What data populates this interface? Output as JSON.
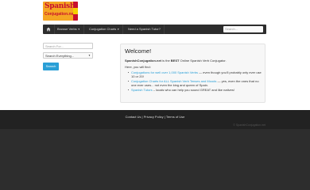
{
  "logo": {
    "line1": "Spanish",
    "line2": "Conjugation.net"
  },
  "nav": {
    "items": [
      {
        "label": "Browse Verbs"
      },
      {
        "label": "Conjugation Charts"
      },
      {
        "label": "Need a Spanish Tutor?"
      }
    ],
    "search_placeholder": "Search..."
  },
  "sidebar": {
    "search_placeholder": "Search For...",
    "select_value": "Search Everything...",
    "button_label": "Search"
  },
  "welcome": {
    "title": "Welcome!",
    "intro_bold": "SpanishConjugation.net",
    "intro_mid": " is the ",
    "intro_best": "BEST",
    "intro_end": " Online Spanish Verb Conjugator.",
    "here": "Here, you will find:",
    "items": [
      {
        "link": "Conjugations for well over 1,000 Spanish Verbs",
        "text": " — even though you'll probably only ever use 10 or 20!"
      },
      {
        "link": "Conjugation Charts for ALL Spanish Verb Tenses and Moods",
        "text": " — yes, even the ones that no one ever uses... not even the king and queen of Spain."
      },
      {
        "link": "Spanish Tutors",
        "text": " – locals who can help you sound GREAT and like natives!"
      }
    ]
  },
  "footer": {
    "links": [
      "Contact Us",
      "Privacy Policy",
      "Terms of Use"
    ],
    "copyright": "© SpanishConjugation.net"
  },
  "colors": {
    "accent": "#2a9fd6",
    "navbar": "#2d2d2d",
    "footer": "#222222"
  }
}
